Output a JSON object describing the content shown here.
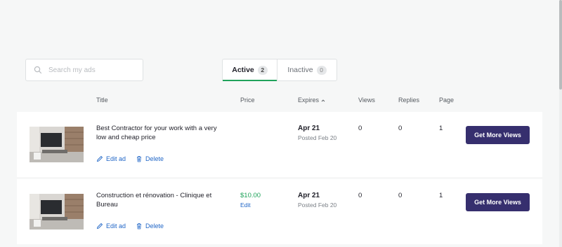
{
  "search": {
    "placeholder": "Search my ads"
  },
  "tabs": [
    {
      "label": "Active",
      "count": "2"
    },
    {
      "label": "Inactive",
      "count": "0"
    }
  ],
  "columns": {
    "title": "Title",
    "price": "Price",
    "expires": "Expires",
    "views": "Views",
    "replies": "Replies",
    "page": "Page"
  },
  "ads": [
    {
      "title": "Best Contractor for your work with a very low and cheap price",
      "price": "",
      "price_edit": "",
      "expires": "Apr 21",
      "posted": "Posted Feb 20",
      "views": "0",
      "replies": "0",
      "page": "1",
      "edit_label": "Edit ad",
      "delete_label": "Delete",
      "cta_label": "Get More Views"
    },
    {
      "title": "Construction et rénovation - Clinique et Bureau",
      "price": "$10.00",
      "price_edit": "Edit",
      "expires": "Apr 21",
      "posted": "Posted Feb 20",
      "views": "0",
      "replies": "0",
      "page": "1",
      "edit_label": "Edit ad",
      "delete_label": "Delete",
      "cta_label": "Get More Views"
    }
  ],
  "colors": {
    "accent_green": "#20a35b",
    "link_blue": "#2066c7",
    "button_purple": "#362f6e"
  }
}
